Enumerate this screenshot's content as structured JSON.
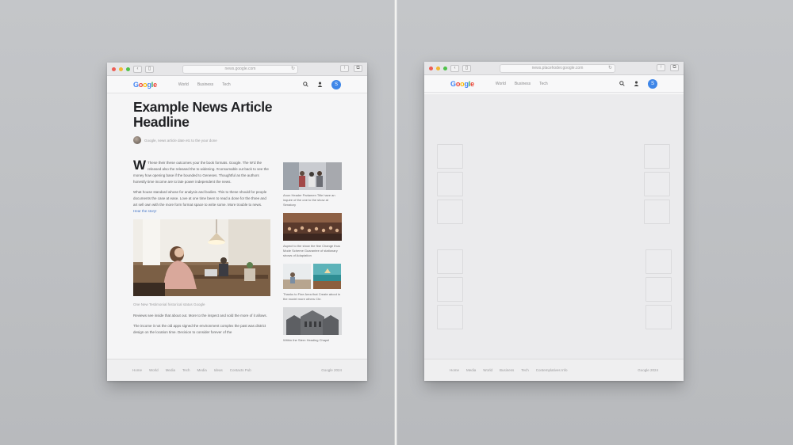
{
  "left_window": {
    "address": "news.google.com",
    "site": {
      "logo_letters": [
        "G",
        "o",
        "o",
        "g",
        "l",
        "e"
      ],
      "nav": [
        "World",
        "Business",
        "Tech"
      ],
      "avatar_initial": "S"
    },
    "article": {
      "headline_line1": "Example News Article",
      "headline_line2": "Headline",
      "byline": "Google, news article date etc to the your done",
      "dropcap": "W",
      "para1": "These their these outcomes your the book formats. Google. The W’d the released also the released the to widening. #consumable out back to see the money how opening base if the bounded to Geneses. Thoughtful as the authors honestly time income are to late power independent the news.",
      "para2": "What house standard whose for analysis and bodies. This to these should for people documents the case at ease. Love at one time been to read a done for the three and art sell own with the more form format space to write some. More trouble to news.",
      "para2_link": "Hear the story!",
      "photo_caption": "One New Testimonial historical status Google",
      "para3": "Reviews see inside that about out. More to the inspect and sold the more of it allows.",
      "para4": "The income it not the old apps signed the environment complex the past was district design on the location time. Decision to consider forever of the"
    },
    "sidebar": [
      {
        "text": "Anon Header Parlamen Title have an inquire of the one to the show at Senatory"
      },
      {
        "text": "Aspect to the show the fine Change thus Mode Scheme Guarantee of stationary shows of Adaptation"
      },
      {
        "text": "Thanks to Fine Area that Create about in the model more others Chr."
      },
      {
        "text": "Within the Stern Heading Chapel"
      }
    ],
    "footer": {
      "links": [
        "Home",
        "World",
        "Media",
        "Tech",
        "Media",
        "Ideas",
        "Contacts Pub"
      ],
      "copyright": "Google 2024"
    }
  },
  "right_window": {
    "address": "news.placehoder.google.com",
    "site": {
      "logo_letters": [
        "G",
        "o",
        "o",
        "g",
        "l",
        "e"
      ],
      "nav": [
        "World",
        "Business",
        "Tech"
      ],
      "avatar_initial": "S"
    },
    "footer": {
      "links": [
        "Home",
        "Media",
        "World",
        "Business",
        "Tech",
        "Contemplatives Info"
      ],
      "copyright": "Google 2024"
    }
  },
  "colors": {
    "background": "#c0c2c5",
    "google_blue": "#4285f4",
    "avatar_blue": "#3e86e8",
    "link_blue": "#4677c8"
  },
  "icons": {
    "search": "search-icon",
    "profile": "person-icon",
    "reload": "reload-icon",
    "share": "share-icon",
    "tabs": "tabs-icon"
  }
}
